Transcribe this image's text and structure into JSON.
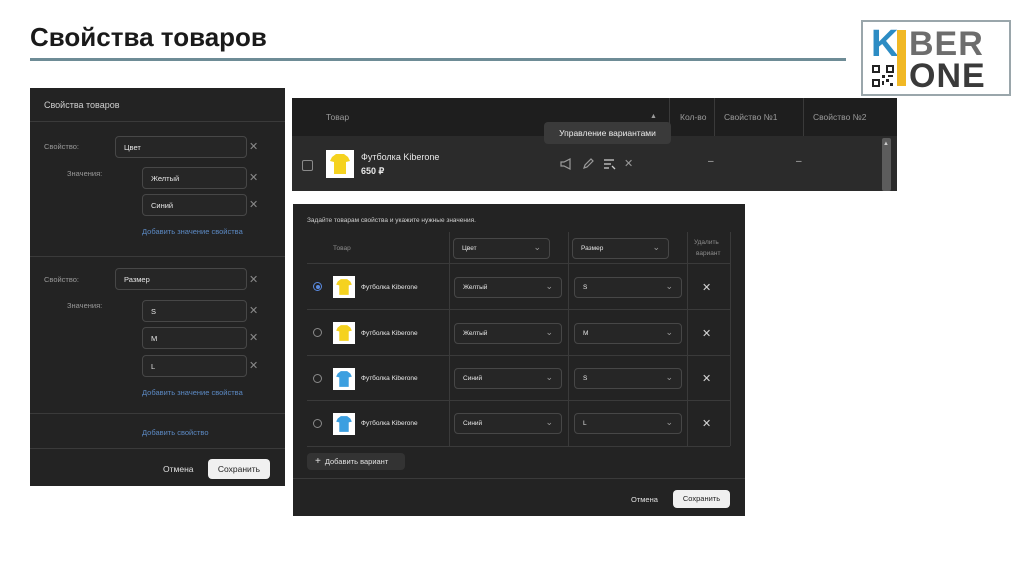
{
  "slide": {
    "title": "Свойства товаров"
  },
  "logo": {
    "k": "K",
    "ber": "BER",
    "one": "ONE"
  },
  "colors": {
    "accent": "#5c8ac4",
    "yellow_shirt": "#f5d21f",
    "blue_shirt": "#3b9fe0",
    "panel_bg": "#232323"
  },
  "props_panel": {
    "title": "Свойства товаров",
    "prop_label": "Свойство:",
    "values_label": "Значения:",
    "prop1": {
      "name": "Цвет",
      "values": [
        "Желтый",
        "Синий"
      ]
    },
    "prop2": {
      "name": "Размер",
      "values": [
        "S",
        "M",
        "L"
      ]
    },
    "add_value_link": "Добавить значение свойства",
    "add_prop_link": "Добавить свойство",
    "cancel": "Отмена",
    "save": "Сохранить"
  },
  "product_table": {
    "columns": [
      "Товар",
      "Кол-во",
      "Свойство №1",
      "Свойство №2"
    ],
    "row": {
      "name": "Футболка Kiberone",
      "price": "650 ₽",
      "qty": "–",
      "prop1": "–"
    },
    "tooltip": "Управление вариантами",
    "icons": [
      "megaphone-icon",
      "pencil-icon",
      "variants-icon",
      "close-icon"
    ]
  },
  "variants_panel": {
    "intro": "Задайте товарам свойства и укажите нужные значения.",
    "col_product": "Товар",
    "col_prop1": "Цвет",
    "col_prop2": "Размер",
    "col_delete_1": "Удалить",
    "col_delete_2": "вариант",
    "rows": [
      {
        "name": "Футболка Kiberone",
        "color": "Желтый",
        "size": "S",
        "selected": true
      },
      {
        "name": "Футболка Kiberone",
        "color": "Желтый",
        "size": "M",
        "selected": false
      },
      {
        "name": "Футболка Kiberone",
        "color": "Синий",
        "size": "S",
        "selected": false
      },
      {
        "name": "Футболка Kiberone",
        "color": "Синий",
        "size": "L",
        "selected": false
      }
    ],
    "add_variant": "Добавить вариант",
    "cancel": "Отмена",
    "save": "Сохранить"
  }
}
